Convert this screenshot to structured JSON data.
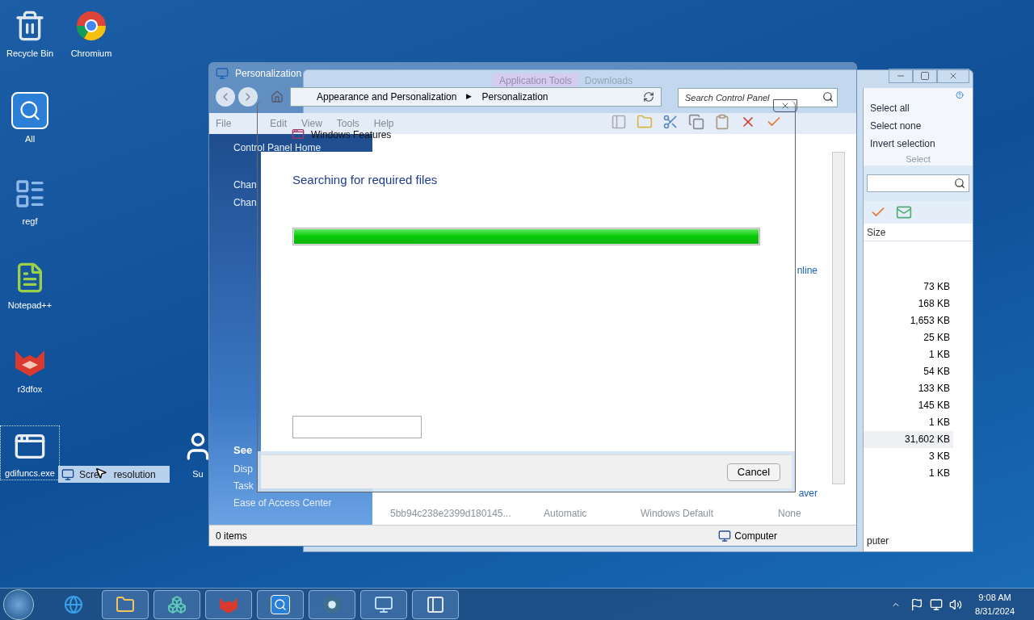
{
  "desktop_icons": [
    {
      "label": "Recycle Bin",
      "kind": "recycle",
      "selected": false
    },
    {
      "label": "Chromium",
      "kind": "browser",
      "selected": false
    },
    {
      "label": "All",
      "kind": "search",
      "selected": false
    },
    {
      "label": "regf",
      "kind": "list",
      "selected": false
    },
    {
      "label": "Notepad++",
      "kind": "notepad",
      "selected": false
    },
    {
      "label": "r3dfox",
      "kind": "fox",
      "selected": false
    },
    {
      "label": "gdifuncs.exe",
      "kind": "window",
      "selected": true
    },
    {
      "label": "Su",
      "kind": "figure",
      "selected": false
    }
  ],
  "drag_tooltip": {
    "label_parts": [
      "Scre",
      "resolution"
    ]
  },
  "explorer_window": {
    "ribbon_tabs": [
      {
        "label": "Application Tools",
        "selected": true
      },
      {
        "label": "Downloads",
        "selected": false
      }
    ],
    "select_group": {
      "items": [
        "Select all",
        "Select none",
        "Invert selection"
      ],
      "title": "Select"
    },
    "column_header": "Size",
    "sizes": [
      {
        "text": "73 KB",
        "selected": false
      },
      {
        "text": "168 KB",
        "selected": false
      },
      {
        "text": "1,653 KB",
        "selected": false
      },
      {
        "text": "25 KB",
        "selected": false
      },
      {
        "text": "1 KB",
        "selected": false
      },
      {
        "text": "54 KB",
        "selected": false
      },
      {
        "text": "133 KB",
        "selected": false
      },
      {
        "text": "145 KB",
        "selected": false
      },
      {
        "text": "1 KB",
        "selected": false
      },
      {
        "text": "31,602 KB",
        "selected": true
      },
      {
        "text": "3 KB",
        "selected": false
      },
      {
        "text": "1 KB",
        "selected": false
      }
    ],
    "status_text": "puter"
  },
  "personalization": {
    "title": "Personalization",
    "breadcrumb": [
      "Appearance and Personalization",
      "Personalization"
    ],
    "breadcrumb_separator": "▶",
    "search_placeholder": "Search Control Panel",
    "menu": [
      "File",
      "Edit",
      "View",
      "Tools",
      "Help"
    ],
    "sidebar_links": [
      "Control Panel Home",
      "Chan",
      "Chan"
    ],
    "see_also": {
      "title": "See",
      "links": [
        "Disp",
        "Task",
        "Ease of Access Center"
      ]
    },
    "link_fragment": "nline",
    "label_fragment": "aver",
    "theme_row": [
      "5bb94c238e2399d180145...",
      "Automatic",
      "Windows Default",
      "None"
    ],
    "status": {
      "items": "0 items",
      "location": "Computer"
    }
  },
  "dialog": {
    "title": "Windows Features",
    "heading": "Searching for required files",
    "progress": {
      "level": 1.0
    },
    "cancel": "Cancel"
  },
  "taskbar": {
    "apps": [
      {
        "kind": "ie"
      },
      {
        "kind": "folder"
      },
      {
        "kind": "cubes"
      },
      {
        "kind": "fox"
      },
      {
        "kind": "search"
      },
      {
        "kind": "browser"
      },
      {
        "kind": "panel"
      },
      {
        "kind": "features"
      }
    ],
    "clock": {
      "time": "9:08 AM",
      "date": "8/31/2024"
    }
  }
}
